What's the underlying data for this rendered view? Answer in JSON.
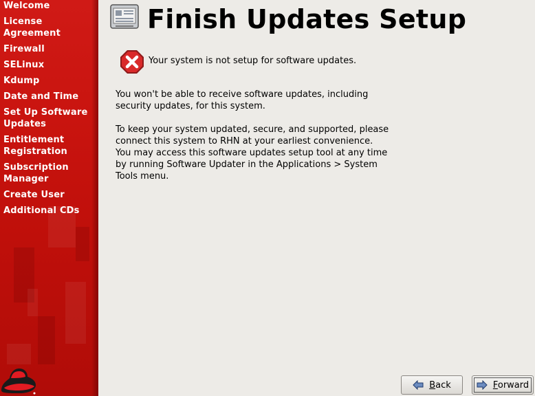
{
  "sidebar": {
    "items": [
      {
        "label": "Welcome"
      },
      {
        "label": "License Agreement"
      },
      {
        "label": "Firewall"
      },
      {
        "label": "SELinux"
      },
      {
        "label": "Kdump"
      },
      {
        "label": "Date and Time"
      },
      {
        "label": "Set Up Software Updates"
      },
      {
        "label": "Entitlement Registration"
      },
      {
        "label": "Subscription Manager"
      },
      {
        "label": "Create User"
      },
      {
        "label": "Additional CDs"
      }
    ]
  },
  "header": {
    "title": "Finish Updates Setup"
  },
  "main": {
    "error_message": "Your system is not setup for software updates.",
    "paragraph1": "You won't be able to receive software updates, including security updates, for this system.",
    "paragraph2": "To keep your system updated, secure, and supported, please connect this system to RHN at your earliest convenience. You may access this software updates setup tool at any time by running Software Updater in the Applications > System Tools menu."
  },
  "buttons": {
    "back_mnemonic": "B",
    "back_rest": "ack",
    "forward_mnemonic": "F",
    "forward_rest": "orward"
  },
  "colors": {
    "sidebar_red": "#c9140f",
    "background": "#edebe7",
    "error_red": "#d92a2a"
  },
  "icons": [
    "header-window-icon",
    "error-icon",
    "back-arrow-icon",
    "forward-arrow-icon",
    "redhat-logo"
  ]
}
